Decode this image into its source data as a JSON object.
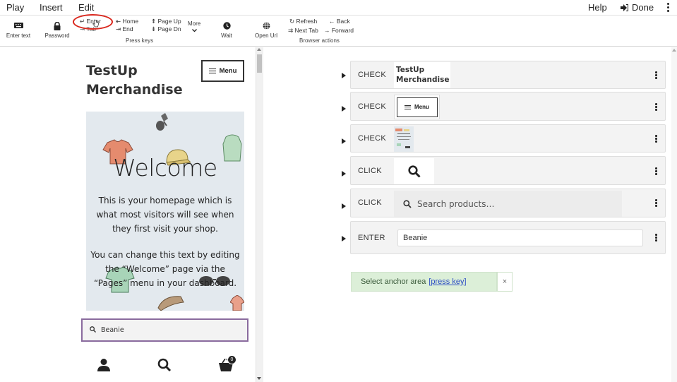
{
  "menubar": {
    "tabs": [
      "Play",
      "Insert",
      "Edit"
    ],
    "help": "Help",
    "done": "Done"
  },
  "toolbar": {
    "enter_text": "Enter text",
    "password": "Password",
    "keys": {
      "enter": "↵ Enter",
      "tab": "⇥ Tab",
      "home": "⇤ Home",
      "end": "⇥ End",
      "page_up": "⇞ Page Up",
      "page_dn": "⇟ Page Dn",
      "more": "More",
      "group_label": "Press keys"
    },
    "wait": "Wait",
    "open_url": "Open Url",
    "browser": {
      "refresh": "↻ Refresh",
      "back": "← Back",
      "next_tab": "⇉ Next Tab",
      "forward": "→ Forward",
      "group_label": "Browser actions"
    }
  },
  "preview": {
    "site_title": "TestUp Merchandise",
    "menu_label": "Menu",
    "hero_heading": "Welcome",
    "hero_p1": "This is your homepage which is what most visitors will see when they first visit your shop.",
    "hero_p2": "You can change this text by editing the “Welcome” page via the “Pages” menu in your dashboard.",
    "search_value": "Beanie",
    "cart_count": "0"
  },
  "steps": [
    {
      "keyword": "CHECK",
      "snapshot": "TestUp Merchandise"
    },
    {
      "keyword": "CHECK",
      "snapshot": "Menu"
    },
    {
      "keyword": "CHECK",
      "snapshot": ""
    },
    {
      "keyword": "CLICK",
      "snapshot": ""
    },
    {
      "keyword": "CLICK",
      "snapshot": "Search products…"
    },
    {
      "keyword": "ENTER",
      "value": "Beanie"
    }
  ],
  "anchor_hint": {
    "text": "Select anchor area",
    "link": "[press key]",
    "close": "×"
  },
  "colors": {
    "highlight_circle": "#d9261c",
    "anchor_bg": "#dcefd8",
    "link": "#2a4cc4",
    "search_border": "#8a6b9e"
  }
}
